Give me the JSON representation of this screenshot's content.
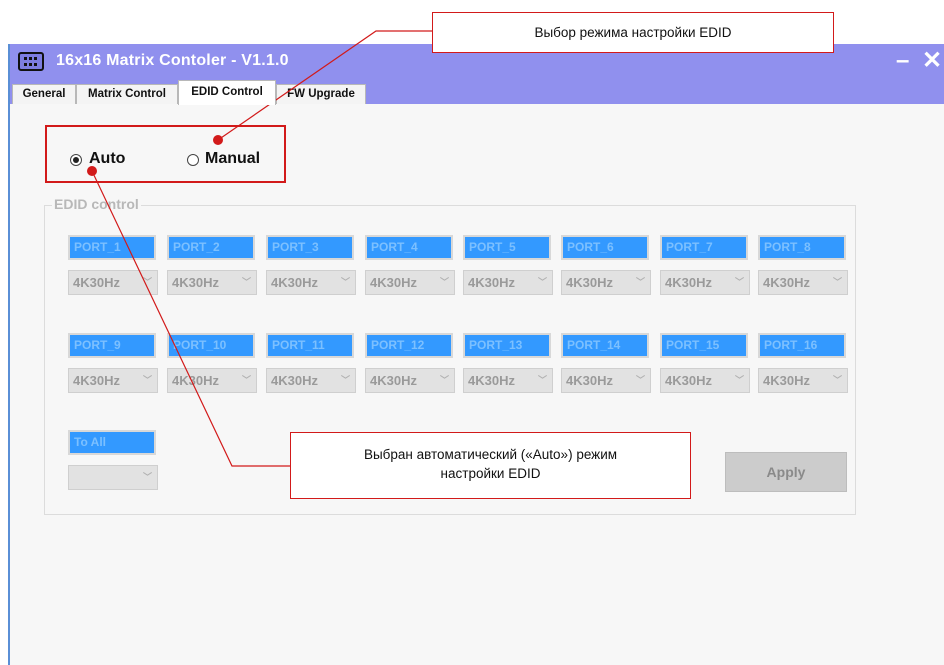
{
  "window": {
    "title": "16x16 Matrix Contoler - V1.1.0",
    "minimize_glyph": "–",
    "close_glyph": "✕"
  },
  "tabs": [
    {
      "label": "General"
    },
    {
      "label": "Matrix Control"
    },
    {
      "label": "EDID Control",
      "active": true
    },
    {
      "label": "FW Upgrade"
    }
  ],
  "mode": {
    "auto_label": "Auto",
    "manual_label": "Manual",
    "selected": "Auto"
  },
  "edid": {
    "group_title": "EDID control",
    "ports": [
      {
        "label": "PORT_1",
        "value": "4K30Hz"
      },
      {
        "label": "PORT_2",
        "value": "4K30Hz"
      },
      {
        "label": "PORT_3",
        "value": "4K30Hz"
      },
      {
        "label": "PORT_4",
        "value": "4K30Hz"
      },
      {
        "label": "PORT_5",
        "value": "4K30Hz"
      },
      {
        "label": "PORT_6",
        "value": "4K30Hz"
      },
      {
        "label": "PORT_7",
        "value": "4K30Hz"
      },
      {
        "label": "PORT_8",
        "value": "4K30Hz"
      },
      {
        "label": "PORT_9",
        "value": "4K30Hz"
      },
      {
        "label": "PORT_10",
        "value": "4K30Hz"
      },
      {
        "label": "PORT_11",
        "value": "4K30Hz"
      },
      {
        "label": "PORT_12",
        "value": "4K30Hz"
      },
      {
        "label": "PORT_13",
        "value": "4K30Hz"
      },
      {
        "label": "PORT_14",
        "value": "4K30Hz"
      },
      {
        "label": "PORT_15",
        "value": "4K30Hz"
      },
      {
        "label": "PORT_16",
        "value": "4K30Hz"
      }
    ],
    "to_all_label": "To All",
    "to_all_value": "",
    "apply_label": "Apply"
  },
  "annotations": {
    "top_callout": "Выбор режима настройки EDID",
    "bottom_callout_line1": "Выбран автоматический («Auto») режим",
    "bottom_callout_line2": "настройки EDID",
    "highlight_color": "#d21a1a"
  },
  "colors": {
    "titlebar": "#9090ee",
    "port_button": "#3399ff"
  }
}
